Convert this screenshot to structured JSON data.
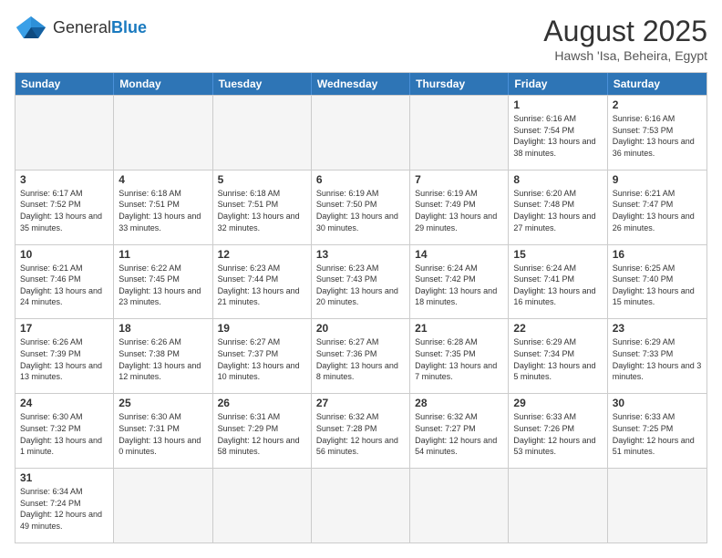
{
  "logo": {
    "text_general": "General",
    "text_blue": "Blue"
  },
  "title": "August 2025",
  "subtitle": "Hawsh 'Isa, Beheira, Egypt",
  "days_of_week": [
    "Sunday",
    "Monday",
    "Tuesday",
    "Wednesday",
    "Thursday",
    "Friday",
    "Saturday"
  ],
  "weeks": [
    [
      {
        "day": "",
        "empty": true
      },
      {
        "day": "",
        "empty": true
      },
      {
        "day": "",
        "empty": true
      },
      {
        "day": "",
        "empty": true
      },
      {
        "day": "",
        "empty": true
      },
      {
        "day": "1",
        "sunrise": "6:16 AM",
        "sunset": "7:54 PM",
        "daylight": "13 hours and 38 minutes."
      },
      {
        "day": "2",
        "sunrise": "6:16 AM",
        "sunset": "7:53 PM",
        "daylight": "13 hours and 36 minutes."
      }
    ],
    [
      {
        "day": "3",
        "sunrise": "6:17 AM",
        "sunset": "7:52 PM",
        "daylight": "13 hours and 35 minutes."
      },
      {
        "day": "4",
        "sunrise": "6:18 AM",
        "sunset": "7:51 PM",
        "daylight": "13 hours and 33 minutes."
      },
      {
        "day": "5",
        "sunrise": "6:18 AM",
        "sunset": "7:51 PM",
        "daylight": "13 hours and 32 minutes."
      },
      {
        "day": "6",
        "sunrise": "6:19 AM",
        "sunset": "7:50 PM",
        "daylight": "13 hours and 30 minutes."
      },
      {
        "day": "7",
        "sunrise": "6:19 AM",
        "sunset": "7:49 PM",
        "daylight": "13 hours and 29 minutes."
      },
      {
        "day": "8",
        "sunrise": "6:20 AM",
        "sunset": "7:48 PM",
        "daylight": "13 hours and 27 minutes."
      },
      {
        "day": "9",
        "sunrise": "6:21 AM",
        "sunset": "7:47 PM",
        "daylight": "13 hours and 26 minutes."
      }
    ],
    [
      {
        "day": "10",
        "sunrise": "6:21 AM",
        "sunset": "7:46 PM",
        "daylight": "13 hours and 24 minutes."
      },
      {
        "day": "11",
        "sunrise": "6:22 AM",
        "sunset": "7:45 PM",
        "daylight": "13 hours and 23 minutes."
      },
      {
        "day": "12",
        "sunrise": "6:23 AM",
        "sunset": "7:44 PM",
        "daylight": "13 hours and 21 minutes."
      },
      {
        "day": "13",
        "sunrise": "6:23 AM",
        "sunset": "7:43 PM",
        "daylight": "13 hours and 20 minutes."
      },
      {
        "day": "14",
        "sunrise": "6:24 AM",
        "sunset": "7:42 PM",
        "daylight": "13 hours and 18 minutes."
      },
      {
        "day": "15",
        "sunrise": "6:24 AM",
        "sunset": "7:41 PM",
        "daylight": "13 hours and 16 minutes."
      },
      {
        "day": "16",
        "sunrise": "6:25 AM",
        "sunset": "7:40 PM",
        "daylight": "13 hours and 15 minutes."
      }
    ],
    [
      {
        "day": "17",
        "sunrise": "6:26 AM",
        "sunset": "7:39 PM",
        "daylight": "13 hours and 13 minutes."
      },
      {
        "day": "18",
        "sunrise": "6:26 AM",
        "sunset": "7:38 PM",
        "daylight": "13 hours and 12 minutes."
      },
      {
        "day": "19",
        "sunrise": "6:27 AM",
        "sunset": "7:37 PM",
        "daylight": "13 hours and 10 minutes."
      },
      {
        "day": "20",
        "sunrise": "6:27 AM",
        "sunset": "7:36 PM",
        "daylight": "13 hours and 8 minutes."
      },
      {
        "day": "21",
        "sunrise": "6:28 AM",
        "sunset": "7:35 PM",
        "daylight": "13 hours and 7 minutes."
      },
      {
        "day": "22",
        "sunrise": "6:29 AM",
        "sunset": "7:34 PM",
        "daylight": "13 hours and 5 minutes."
      },
      {
        "day": "23",
        "sunrise": "6:29 AM",
        "sunset": "7:33 PM",
        "daylight": "13 hours and 3 minutes."
      }
    ],
    [
      {
        "day": "24",
        "sunrise": "6:30 AM",
        "sunset": "7:32 PM",
        "daylight": "13 hours and 1 minute."
      },
      {
        "day": "25",
        "sunrise": "6:30 AM",
        "sunset": "7:31 PM",
        "daylight": "13 hours and 0 minutes."
      },
      {
        "day": "26",
        "sunrise": "6:31 AM",
        "sunset": "7:29 PM",
        "daylight": "12 hours and 58 minutes."
      },
      {
        "day": "27",
        "sunrise": "6:32 AM",
        "sunset": "7:28 PM",
        "daylight": "12 hours and 56 minutes."
      },
      {
        "day": "28",
        "sunrise": "6:32 AM",
        "sunset": "7:27 PM",
        "daylight": "12 hours and 54 minutes."
      },
      {
        "day": "29",
        "sunrise": "6:33 AM",
        "sunset": "7:26 PM",
        "daylight": "12 hours and 53 minutes."
      },
      {
        "day": "30",
        "sunrise": "6:33 AM",
        "sunset": "7:25 PM",
        "daylight": "12 hours and 51 minutes."
      }
    ],
    [
      {
        "day": "31",
        "sunrise": "6:34 AM",
        "sunset": "7:24 PM",
        "daylight": "12 hours and 49 minutes."
      },
      {
        "day": "",
        "empty": true
      },
      {
        "day": "",
        "empty": true
      },
      {
        "day": "",
        "empty": true
      },
      {
        "day": "",
        "empty": true
      },
      {
        "day": "",
        "empty": true
      },
      {
        "day": "",
        "empty": true
      }
    ]
  ]
}
